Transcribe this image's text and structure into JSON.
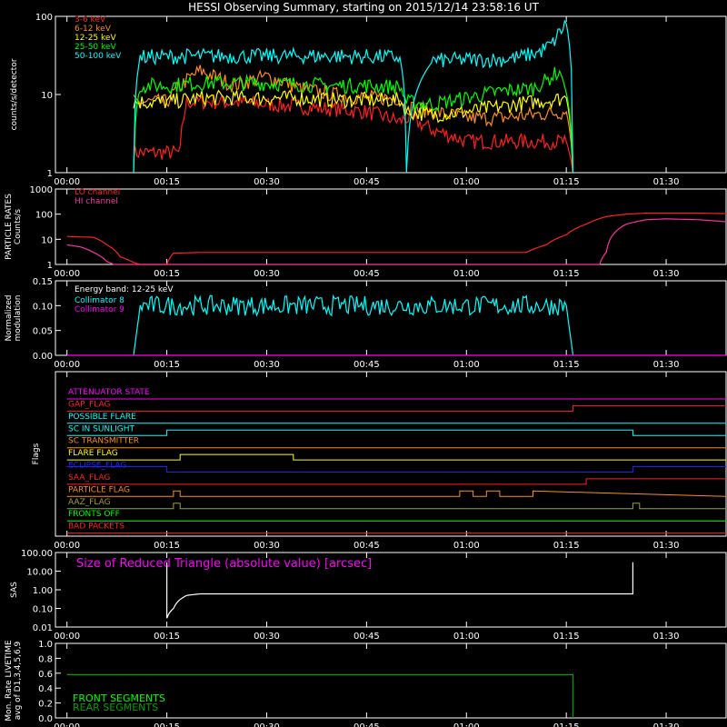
{
  "title": "HESSI Observing Summary, starting on 2015/12/14 23:58:16 UT",
  "time_ticks": [
    "00:00",
    "00:15",
    "00:30",
    "00:45",
    "01:00",
    "01:15",
    "01:30"
  ],
  "colors": {
    "background": "#000000",
    "axes": "#ffffff",
    "red": "#ff2020",
    "orange": "#ff8c1a",
    "yellow": "#ffff00",
    "green": "#00ff00",
    "cyan": "#00ffff",
    "magenta": "#ff00ff",
    "blue": "#2020ff",
    "olive": "#a0a030",
    "darkgreen": "#00a000"
  },
  "chart_data": [
    {
      "panel": "count-rates",
      "type": "line",
      "ylabel": "counts/s/detector",
      "yscale": "log",
      "ylim": [
        1,
        100
      ],
      "yticks": [
        "1",
        "10",
        "100"
      ],
      "series": [
        {
          "name": "3-6 keV",
          "color": "#ff2020",
          "x": [
            "00:10",
            "00:17",
            "00:18",
            "00:25",
            "00:35",
            "00:45",
            "00:50",
            "00:51",
            "00:55",
            "01:00",
            "01:05",
            "01:10",
            "01:15",
            "01:16"
          ],
          "y": [
            1.8,
            1.8,
            8,
            8,
            7,
            6,
            4.5,
            5,
            3.5,
            2.5,
            2.5,
            2.5,
            2.5,
            1
          ]
        },
        {
          "name": "6-12 keV",
          "color": "#ff8c1a",
          "x": [
            "00:10",
            "00:15",
            "00:20",
            "00:25",
            "00:30",
            "00:35",
            "00:40",
            "00:45",
            "00:50",
            "00:51",
            "00:55",
            "01:00",
            "01:05",
            "01:10",
            "01:15",
            "01:16"
          ],
          "y": [
            8,
            8,
            20,
            13,
            17,
            12,
            10,
            9,
            9,
            7,
            6,
            5,
            5,
            5.5,
            6,
            1
          ]
        },
        {
          "name": "12-25 keV",
          "color": "#ffff00",
          "x": [
            "00:10",
            "00:15",
            "00:20",
            "00:25",
            "00:30",
            "00:35",
            "00:40",
            "00:45",
            "00:50",
            "00:51",
            "00:55",
            "01:00",
            "01:05",
            "01:10",
            "01:15",
            "01:16"
          ],
          "y": [
            8,
            8,
            9,
            9,
            9,
            9,
            8.5,
            8.5,
            8.5,
            6,
            5.5,
            6,
            7,
            8,
            9,
            1
          ]
        },
        {
          "name": "25-50 keV",
          "color": "#00ff00",
          "x": [
            "00:10",
            "00:11",
            "00:15",
            "00:20",
            "00:25",
            "00:30",
            "00:35",
            "00:40",
            "00:45",
            "00:50",
            "00:51",
            "00:55",
            "01:00",
            "01:05",
            "01:10",
            "01:12",
            "01:14",
            "01:16"
          ],
          "y": [
            1,
            13,
            13,
            14,
            14,
            14,
            13.5,
            13,
            13,
            12.5,
            8,
            7.5,
            9,
            11,
            12,
            15,
            20,
            1
          ]
        },
        {
          "name": "50-100 keV",
          "color": "#00ffff",
          "x": [
            "00:10",
            "00:11",
            "00:20",
            "00:30",
            "00:40",
            "00:50",
            "00:51",
            "00:55",
            "01:00",
            "01:05",
            "01:08",
            "01:11",
            "01:13",
            "01:15",
            "01:16"
          ],
          "y": [
            1,
            30,
            31,
            31,
            31,
            30,
            1,
            27,
            28,
            28,
            30,
            35,
            45,
            80,
            1
          ]
        }
      ]
    },
    {
      "panel": "particle-rates",
      "type": "line",
      "ylabel": "PARTICLE RATES Counts/s",
      "yscale": "log",
      "ylim": [
        1,
        1000
      ],
      "yticks": [
        "1",
        "10",
        "100",
        "1000"
      ],
      "series": [
        {
          "name": "LO channel",
          "color": "#ff2020",
          "x": [
            "00:00",
            "00:04",
            "00:06",
            "00:08",
            "00:10",
            "00:11",
            "00:15",
            "00:16",
            "00:20",
            "00:30",
            "00:45",
            "01:00",
            "01:09",
            "01:12",
            "01:15",
            "01:18",
            "01:21",
            "01:24",
            "01:27",
            "01:30",
            "01:35",
            "01:39"
          ],
          "y": [
            13,
            12,
            6,
            2,
            1.2,
            1,
            1,
            2.8,
            3,
            3,
            3,
            3,
            3,
            6,
            15,
            40,
            80,
            100,
            110,
            110,
            110,
            105
          ]
        },
        {
          "name": "HI channel",
          "color": "#ff30a0",
          "x": [
            "00:00",
            "00:02",
            "00:04",
            "00:06",
            "00:07",
            "01:20",
            "01:21",
            "01:22",
            "01:24",
            "01:27",
            "01:30",
            "01:35",
            "01:39"
          ],
          "y": [
            6,
            5,
            3,
            1.3,
            1,
            1,
            3,
            15,
            40,
            60,
            65,
            60,
            50
          ]
        }
      ]
    },
    {
      "panel": "modulation",
      "type": "line",
      "ylabel": "Normalized modulation",
      "ylim": [
        0,
        0.15
      ],
      "yticks": [
        "0.00",
        "0.05",
        "0.10",
        "0.15"
      ],
      "annotation": "Energy band: 12-25 keV",
      "series": [
        {
          "name": "Collimator 8",
          "color": "#00ffff",
          "x": [
            "00:10",
            "00:11",
            "00:20",
            "00:30",
            "00:40",
            "00:50",
            "01:00",
            "01:10",
            "01:15",
            "01:16"
          ],
          "y": [
            0,
            0.1,
            0.1,
            0.1,
            0.1,
            0.1,
            0.1,
            0.1,
            0.1,
            0
          ]
        },
        {
          "name": "Collimator 9",
          "color": "#ff00ff",
          "x": [
            "00:00",
            "01:39"
          ],
          "y": [
            0,
            0
          ]
        }
      ]
    },
    {
      "panel": "flags",
      "type": "line",
      "ylabel": "Flags",
      "series": [
        {
          "name": "ATTENUATOR STATE",
          "color": "#ff00ff",
          "x": [
            "00:00",
            "01:39"
          ],
          "y": [
            0,
            0
          ]
        },
        {
          "name": "GAP_FLAG",
          "color": "#ff2020",
          "x": [
            "00:00",
            "01:16",
            "01:16",
            "01:39"
          ],
          "y": [
            0,
            0,
            1,
            1
          ]
        },
        {
          "name": "POSSIBLE FLARE",
          "color": "#00ffff",
          "x": [
            "00:00",
            "01:39"
          ],
          "y": [
            0,
            0
          ]
        },
        {
          "name": "SC IN SUNLIGHT",
          "color": "#00ffff",
          "x": [
            "00:00",
            "00:15",
            "00:15",
            "01:25",
            "01:25",
            "01:39"
          ],
          "y": [
            0,
            0,
            1,
            1,
            0,
            0
          ]
        },
        {
          "name": "SC TRANSMITTER",
          "color": "#ff8c1a",
          "x": [
            "00:00",
            "01:39"
          ],
          "y": [
            0,
            0
          ]
        },
        {
          "name": "FLARE FLAG",
          "color": "#ffff00",
          "x": [
            "00:00",
            "00:17",
            "00:17",
            "00:34",
            "00:34",
            "01:39"
          ],
          "y": [
            0,
            0,
            1,
            1,
            0,
            0
          ]
        },
        {
          "name": "ECLIPSE_FLAG",
          "color": "#2020ff",
          "x": [
            "00:00",
            "00:15",
            "00:15",
            "01:25",
            "01:25",
            "01:39"
          ],
          "y": [
            1,
            1,
            0,
            0,
            1,
            1
          ]
        },
        {
          "name": "SAA_FLAG",
          "color": "#ff2020",
          "x": [
            "00:00",
            "01:18",
            "01:18",
            "01:39"
          ],
          "y": [
            0,
            0,
            1,
            1
          ]
        },
        {
          "name": "PARTICLE FLAG",
          "color": "#ff8c1a",
          "x": [
            "00:00",
            "00:16",
            "00:16",
            "00:17",
            "00:17",
            "00:59",
            "00:59",
            "01:01",
            "01:01",
            "01:03",
            "01:03",
            "01:05",
            "01:05",
            "01:10",
            "01:10",
            "01:39"
          ],
          "y": [
            0,
            0,
            1,
            1,
            0,
            0,
            1,
            1,
            0,
            0,
            1,
            1,
            0,
            0,
            1,
            0
          ]
        },
        {
          "name": "AAZ_FLAG",
          "color": "#a0a030",
          "x": [
            "00:00",
            "00:16",
            "00:16",
            "00:17",
            "00:17",
            "01:25",
            "01:25",
            "01:26",
            "01:26",
            "01:39"
          ],
          "y": [
            0,
            0,
            1,
            1,
            0,
            0,
            1,
            1,
            0,
            0
          ]
        },
        {
          "name": "FRONTS OFF",
          "color": "#00ff00",
          "x": [
            "00:00",
            "01:39"
          ],
          "y": [
            0,
            0
          ]
        },
        {
          "name": "BAD PACKETS",
          "color": "#ff2020",
          "x": [
            "00:00",
            "01:39"
          ],
          "y": [
            0,
            0
          ]
        }
      ]
    },
    {
      "panel": "sas",
      "type": "line",
      "ylabel": "SAS",
      "yscale": "log",
      "ylim": [
        0.01,
        100
      ],
      "yticks": [
        "0.01",
        "0.10",
        "1.00",
        "10.00",
        "100.00"
      ],
      "annotation": "Size of Reduced Triangle (absolute value) [arcsec]",
      "series": [
        {
          "name": "",
          "color": "#ffffff",
          "x": [
            "00:15",
            "00:15",
            "00:16",
            "00:17",
            "00:18",
            "00:20",
            "00:25",
            "00:40",
            "01:00",
            "01:15",
            "01:25",
            "01:25"
          ],
          "y": [
            30,
            0.03,
            0.1,
            0.3,
            0.5,
            0.6,
            0.6,
            0.6,
            0.6,
            0.6,
            0.6,
            30
          ]
        }
      ]
    },
    {
      "panel": "livetime",
      "type": "line",
      "ylabel": "Mon. Rate LIVETIME avg of D1,3,4,5,6,9",
      "ylim": [
        0,
        1
      ],
      "yticks": [
        "0.0",
        "0.2",
        "0.4",
        "0.6",
        "0.8",
        "1.0"
      ],
      "series": [
        {
          "name": "FRONT SEGMENTS",
          "color": "#00ff00",
          "x": [],
          "y": []
        },
        {
          "name": "REAR SEGMENTS",
          "color": "#00a000",
          "x": [
            "00:00",
            "01:16",
            "01:16"
          ],
          "y": [
            0.58,
            0.58,
            0
          ]
        }
      ]
    }
  ]
}
